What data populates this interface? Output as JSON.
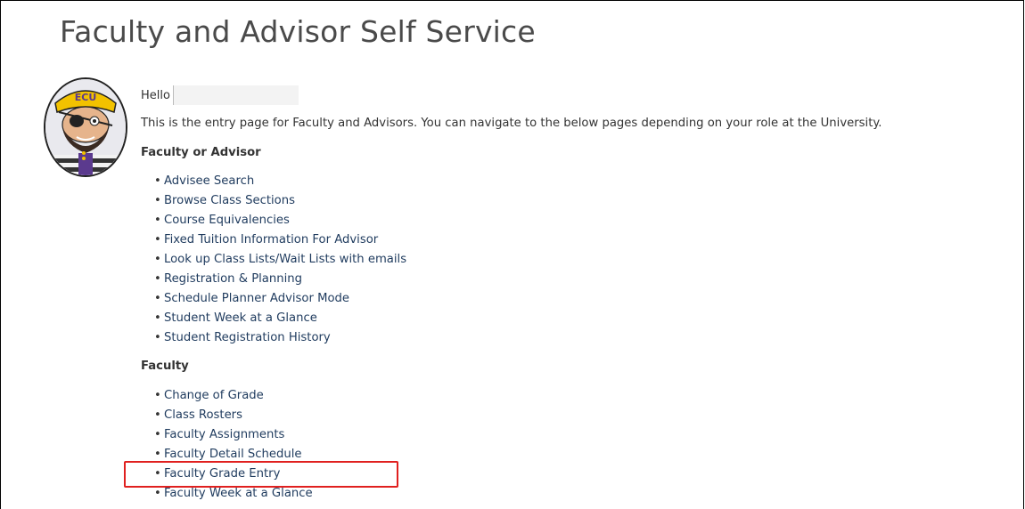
{
  "page": {
    "title": "Faculty and Advisor Self Service",
    "greeting": "Hello",
    "intro": "This is the entry page for Faculty and Advisors. You can navigate to the below pages depending on your role at the University."
  },
  "sections": [
    {
      "heading": "Faculty or Advisor",
      "links": [
        "Advisee Search",
        "Browse Class Sections",
        "Course Equivalencies",
        "Fixed Tuition Information For Advisor",
        "Look up Class Lists/Wait Lists with emails",
        "Registration & Planning",
        "Schedule Planner Advisor Mode",
        "Student Week at a Glance",
        "Student Registration History"
      ]
    },
    {
      "heading": "Faculty",
      "links": [
        "Change of Grade",
        "Class Rosters",
        "Faculty Assignments",
        "Faculty Detail Schedule",
        "Faculty Grade Entry",
        "Faculty Week at a Glance"
      ]
    }
  ],
  "avatar": {
    "label": "ECU",
    "icon": "pirate-mascot-avatar"
  },
  "colors": {
    "link": "#1f3b5e",
    "highlight": "#e0201f",
    "title": "#4a4a4a"
  }
}
